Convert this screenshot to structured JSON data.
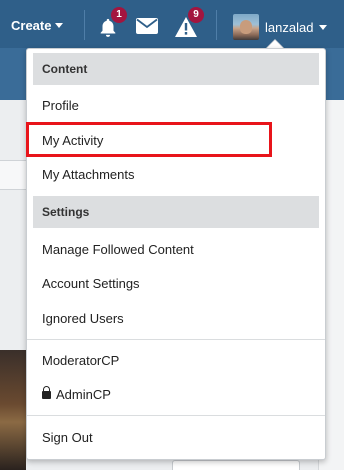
{
  "topbar": {
    "create_label": "Create",
    "notifications_badge": "1",
    "alerts_badge": "9",
    "username": "lanzalad"
  },
  "icons": {
    "bell": "bell-icon",
    "mail": "envelope-icon",
    "alert": "warning-triangle-icon"
  },
  "menu": {
    "content_header": "Content",
    "profile": "Profile",
    "my_activity": "My Activity",
    "my_attachments": "My Attachments",
    "settings_header": "Settings",
    "manage_followed": "Manage Followed Content",
    "account_settings": "Account Settings",
    "ignored_users": "Ignored Users",
    "moderatorcp": "ModeratorCP",
    "admincp": "AdminCP",
    "sign_out": "Sign Out"
  },
  "colors": {
    "topbar": "#2f5f89",
    "badge": "#a3153f",
    "highlight": "#e8141a"
  }
}
